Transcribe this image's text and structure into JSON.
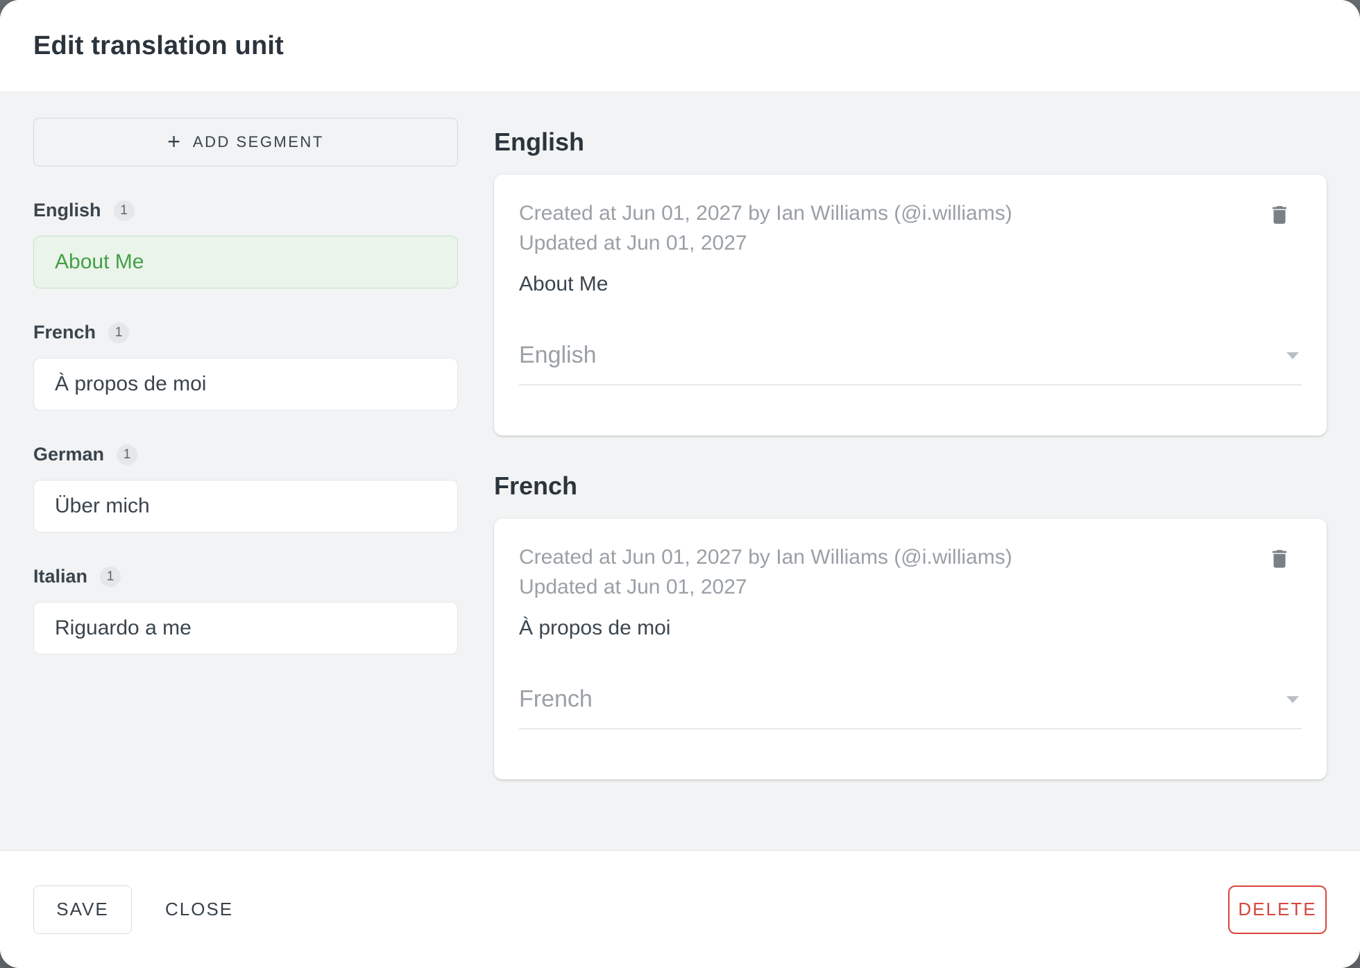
{
  "dialog": {
    "title": "Edit translation unit",
    "colors": {
      "backdrop": "#6d7277",
      "body_background": "#f1f3f4",
      "selected_segment_background": "#eaf4ea",
      "selected_segment_text": "#43a047",
      "delete_accent": "#d9453c"
    },
    "sidebar": {
      "add_segment_label": "ADD SEGMENT",
      "plus_glyph": "+",
      "groups": [
        {
          "language": "English",
          "count": "1",
          "value": "About Me",
          "selected": true
        },
        {
          "language": "French",
          "count": "1",
          "value": "À propos de moi",
          "selected": false
        },
        {
          "language": "German",
          "count": "1",
          "value": "Über mich",
          "selected": false
        },
        {
          "language": "Italian",
          "count": "1",
          "value": "Riguardo a me",
          "selected": false
        }
      ]
    },
    "sections": [
      {
        "heading": "English",
        "created": "Created at Jun 01, 2027 by Ian Williams (@i.williams)",
        "updated": "Updated at Jun 01, 2027",
        "text": "About Me",
        "language_select": "English"
      },
      {
        "heading": "French",
        "created": "Created at Jun 01, 2027 by Ian Williams (@i.williams)",
        "updated": "Updated at Jun 01, 2027",
        "text": "À propos de moi",
        "language_select": "French"
      }
    ],
    "footer": {
      "save_label": "SAVE",
      "close_label": "CLOSE",
      "delete_label": "DELETE"
    }
  }
}
